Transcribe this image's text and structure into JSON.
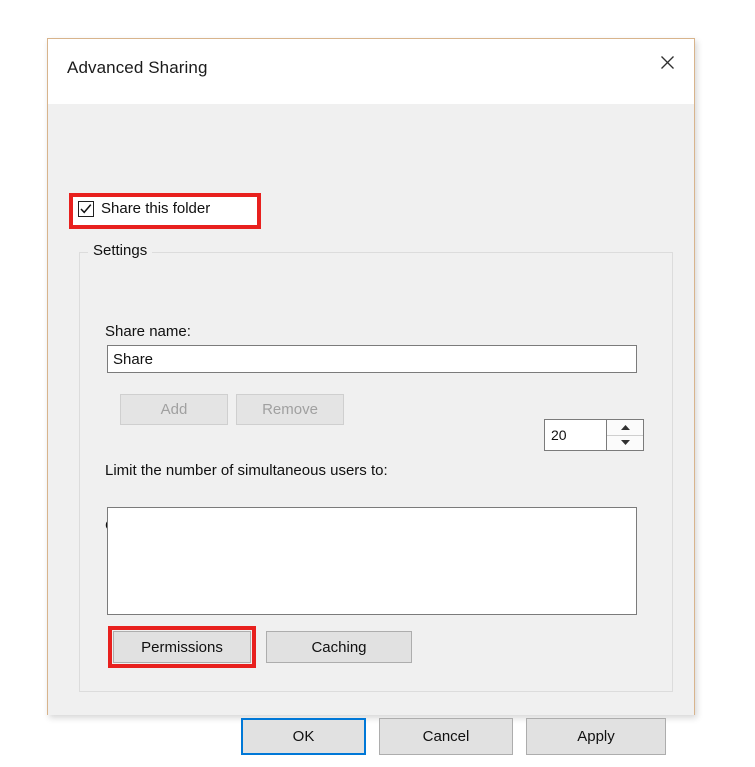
{
  "window": {
    "title": "Advanced Sharing",
    "close_icon": "close-x-icon"
  },
  "share_checkbox": {
    "label": "Share this folder",
    "checked": true,
    "highlight_color": "#e8201e"
  },
  "settings_group": {
    "label": "Settings",
    "share_name": {
      "label": "Share name:",
      "value": "Share",
      "placeholder": ""
    },
    "add_button": {
      "label": "Add",
      "enabled": false
    },
    "remove_button": {
      "label": "Remove",
      "enabled": false
    },
    "user_limit": {
      "label": "Limit the number of simultaneous users to:",
      "value": "20",
      "spin_up_icon": "chevron-up-icon",
      "spin_down_icon": "chevron-down-icon"
    },
    "comments": {
      "label": "Comments:",
      "value": "",
      "placeholder": ""
    },
    "permissions_button": {
      "label": "Permissions",
      "highlighted": true
    },
    "caching_button": {
      "label": "Caching"
    }
  },
  "footer": {
    "ok_label": "OK",
    "cancel_label": "Cancel",
    "apply_label": "Apply",
    "default_button_color": "#0078d7"
  }
}
